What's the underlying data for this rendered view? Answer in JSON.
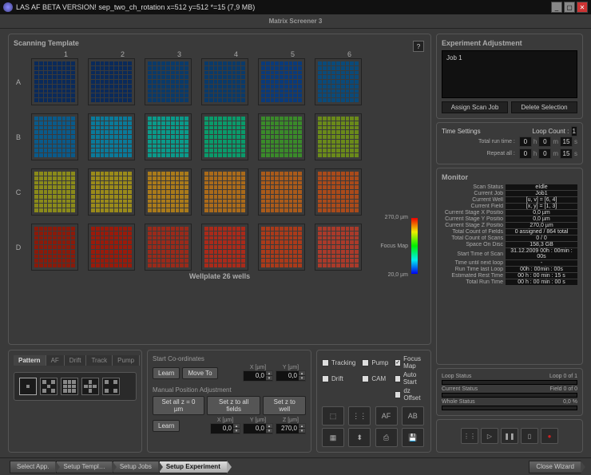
{
  "window": {
    "title": "LAS AF BETA VERSION!  sep_two_ch_rotation x=512 y=512 *=15  (7,9 MB)"
  },
  "subheader": "Matrix Screener 3",
  "scanning": {
    "title": "Scanning Template",
    "cols": [
      "1",
      "2",
      "3",
      "4",
      "5",
      "6"
    ],
    "rows": [
      "A",
      "B",
      "C",
      "D"
    ],
    "wellplate": "Wellplate 26 wells",
    "focusmap_label": "Focus Map",
    "z_max": "270,0 µm",
    "z_min": "20,0 µm"
  },
  "pattern": {
    "tabs": [
      "Pattern",
      "AF",
      "Drift",
      "Track",
      "Pump"
    ]
  },
  "coords": {
    "title": "Start Co-ordinates",
    "learn": "Learn",
    "moveto": "Move To",
    "x_label": "X [µm]",
    "y_label": "Y [µm]",
    "z_label": "Z [µm]",
    "x": "0,0",
    "y": "0,0",
    "z": "270,0"
  },
  "manual": {
    "title": "Manual Position Adjustment",
    "b1": "Set all z = 0 µm",
    "b2": "Set z to all fields",
    "b3": "Set z to well",
    "learn": "Learn"
  },
  "opts": {
    "tracking": "Tracking",
    "drift": "Drift",
    "pump": "Pump",
    "cam": "CAM",
    "focusmap": "Focus Map",
    "autostart": "Auto Start",
    "dzoffset": "dz Offset"
  },
  "icon_btns": [
    "⬚",
    "⋮⋮",
    "AF",
    "AB",
    "▦",
    "⬍",
    "⎙",
    "💾"
  ],
  "experiment": {
    "title": "Experiment Adjustment",
    "job": "Job 1",
    "assign": "Assign Scan Job",
    "delete": "Delete Selection"
  },
  "time": {
    "title": "Time Settings",
    "loopcount_label": "Loop Count :",
    "loopcount": "1",
    "total_label": "Total run time :",
    "repeat_label": "Repeat all :",
    "h": "0",
    "m": "0",
    "m2": "15",
    "s": "0",
    "rh": "0",
    "rm": "0",
    "rm2": "15",
    "rs": "0"
  },
  "monitor": {
    "title": "Monitor",
    "rows": [
      {
        "k": "Scan Status",
        "v": "eIdle"
      },
      {
        "k": "Current Job",
        "v": "Job1"
      },
      {
        "k": "Current Well",
        "v": "[u, v] = [6, 4]"
      },
      {
        "k": "Current Field",
        "v": "[x, y] = [1, 3]"
      },
      {
        "k": "Current Stage X Positio",
        "v": "0,0 µm"
      },
      {
        "k": "Current Stage Y Positio",
        "v": "0,0 µm"
      },
      {
        "k": "Current Stage Z Positio",
        "v": "270,0 µm"
      },
      {
        "k": "Total Count of Fields",
        "v": "0 assigned / 864 total"
      },
      {
        "k": "Total Count of Scans",
        "v": "0 / 0"
      },
      {
        "k": "Space On Disc",
        "v": "158,3 GB"
      },
      {
        "k": "Start Time of Scan",
        "v": "31.12.2009 00h : 00min : 00s"
      },
      {
        "k": "Time until next loop",
        "v": "-"
      },
      {
        "k": "Run Time last Loop",
        "v": "00h : 00min : 00s"
      },
      {
        "k": "Estimated Rest Time",
        "v": "00 h : 00 min : 15 s"
      },
      {
        "k": "Total Run Time",
        "v": "00 h : 00 min : 00 s"
      }
    ]
  },
  "status": {
    "loop": {
      "label": "Loop Status",
      "val": "Loop 0 of 1"
    },
    "current": {
      "label": "Current Status",
      "val": "Field 0 of 0"
    },
    "whole": {
      "label": "Whole Status",
      "val": "0,0 %"
    }
  },
  "wizard": {
    "tabs": [
      "Select App.",
      "Setup Templ…",
      "Setup Jobs",
      "Setup Experiment"
    ],
    "close": "Close Wizard"
  }
}
